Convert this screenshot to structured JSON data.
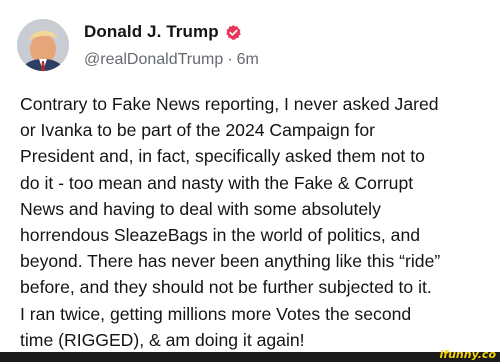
{
  "post": {
    "author": {
      "display_name": "Donald J. Trump",
      "handle": "@realDonaldTrump",
      "verified_icon": "verified-badge-icon",
      "verified_color": "#e8355b"
    },
    "separator": "·",
    "time_ago": "6m",
    "text": "Contrary to Fake News reporting, I never asked Jared\nor Ivanka to be part of the 2024 Campaign for\nPresident and, in fact, specifically asked them not to\ndo it - too mean and nasty with the Fake & Corrupt\nNews and having to deal with some absolutely\nhorrendous SleazeBags in the world of politics, and\nbeyond. There has never been anything like this “ride”\nbefore, and they should not be further subjected to it.\nI ran twice, getting millions more Votes the second\ntime (RIGGED), & am doing it again!"
  },
  "watermark": {
    "text": "ifunny.co",
    "color": "#f5d300"
  }
}
